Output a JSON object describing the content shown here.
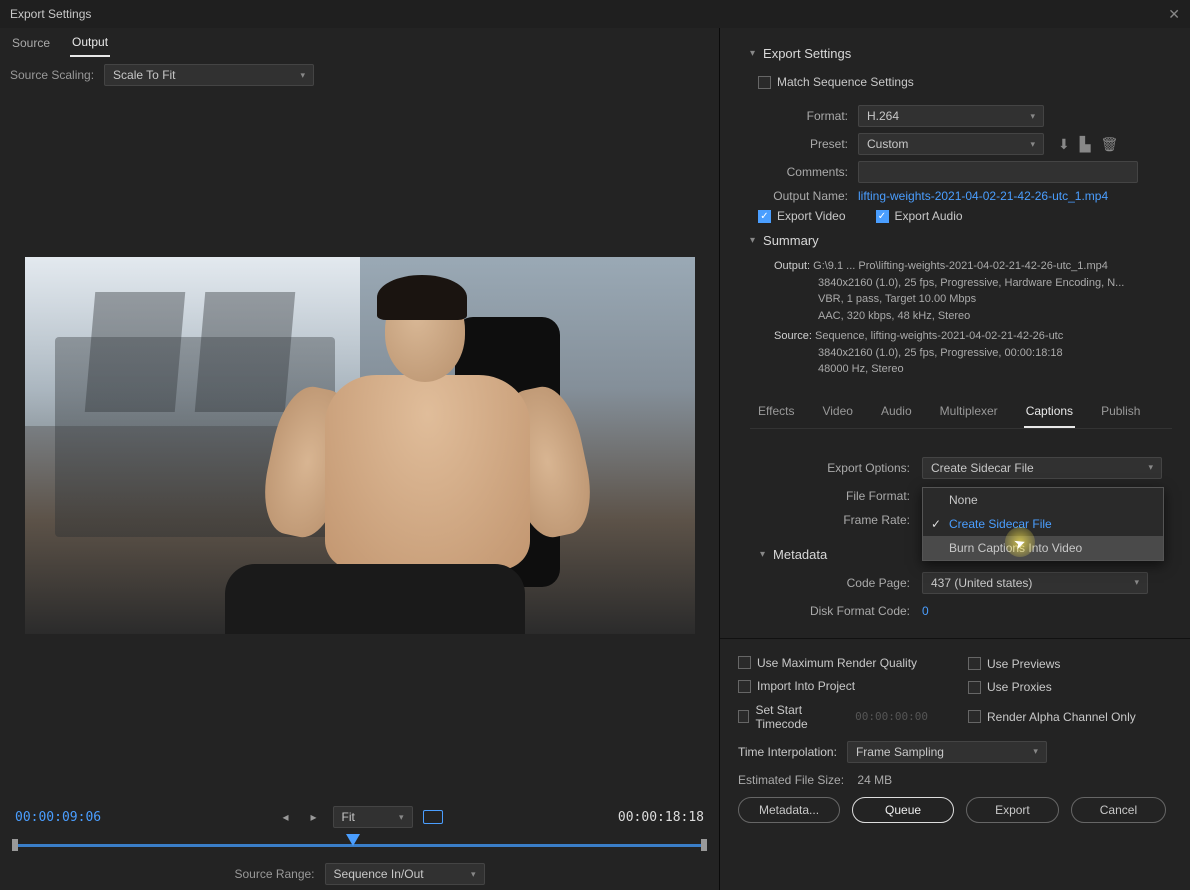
{
  "titlebar": {
    "title": "Export Settings"
  },
  "left": {
    "tabs": {
      "source": "Source",
      "output": "Output"
    },
    "scaling": {
      "label": "Source Scaling:",
      "value": "Scale To Fit"
    },
    "timeline": {
      "current": "00:00:09:06",
      "duration": "00:00:18:18",
      "fit": "Fit",
      "source_range_label": "Source Range:",
      "source_range_value": "Sequence In/Out"
    }
  },
  "export": {
    "header": "Export Settings",
    "match_seq": "Match Sequence Settings",
    "format_label": "Format:",
    "format_value": "H.264",
    "preset_label": "Preset:",
    "preset_value": "Custom",
    "comments_label": "Comments:",
    "output_name_label": "Output Name:",
    "output_name_value": "lifting-weights-2021-04-02-21-42-26-utc_1.mp4",
    "export_video": "Export Video",
    "export_audio": "Export Audio"
  },
  "summary": {
    "header": "Summary",
    "output_label": "Output:",
    "output_l1": "G:\\9.1 ... Pro\\lifting-weights-2021-04-02-21-42-26-utc_1.mp4",
    "output_l2": "3840x2160 (1.0), 25 fps, Progressive, Hardware Encoding, N...",
    "output_l3": "VBR, 1 pass, Target 10.00 Mbps",
    "output_l4": "AAC, 320 kbps, 48 kHz, Stereo",
    "source_label": "Source:",
    "source_l1": "Sequence, lifting-weights-2021-04-02-21-42-26-utc",
    "source_l2": "3840x2160 (1.0), 25 fps, Progressive, 00:00:18:18",
    "source_l3": "48000 Hz, Stereo"
  },
  "tabs2": {
    "effects": "Effects",
    "video": "Video",
    "audio": "Audio",
    "multiplexer": "Multiplexer",
    "captions": "Captions",
    "publish": "Publish"
  },
  "captions": {
    "export_options_label": "Export Options:",
    "export_options_value": "Create Sidecar File",
    "file_format_label": "File Format:",
    "frame_rate_label": "Frame Rate:",
    "menu": {
      "none": "None",
      "sidecar": "Create Sidecar File",
      "burn": "Burn Captions Into Video"
    }
  },
  "metadata": {
    "header": "Metadata",
    "code_page_label": "Code Page:",
    "code_page_value": "437 (United states)",
    "disk_format_label": "Disk Format Code:",
    "disk_format_value": "0"
  },
  "bottom": {
    "max_render": "Use Maximum Render Quality",
    "use_previews": "Use Previews",
    "import_project": "Import Into Project",
    "use_proxies": "Use Proxies",
    "set_start_tc": "Set Start Timecode",
    "start_tc_value": "00:00:00:00",
    "render_alpha": "Render Alpha Channel Only",
    "tinterp_label": "Time Interpolation:",
    "tinterp_value": "Frame Sampling",
    "filesize_label": "Estimated File Size:",
    "filesize_value": "24 MB"
  },
  "buttons": {
    "metadata": "Metadata...",
    "queue": "Queue",
    "export": "Export",
    "cancel": "Cancel"
  }
}
